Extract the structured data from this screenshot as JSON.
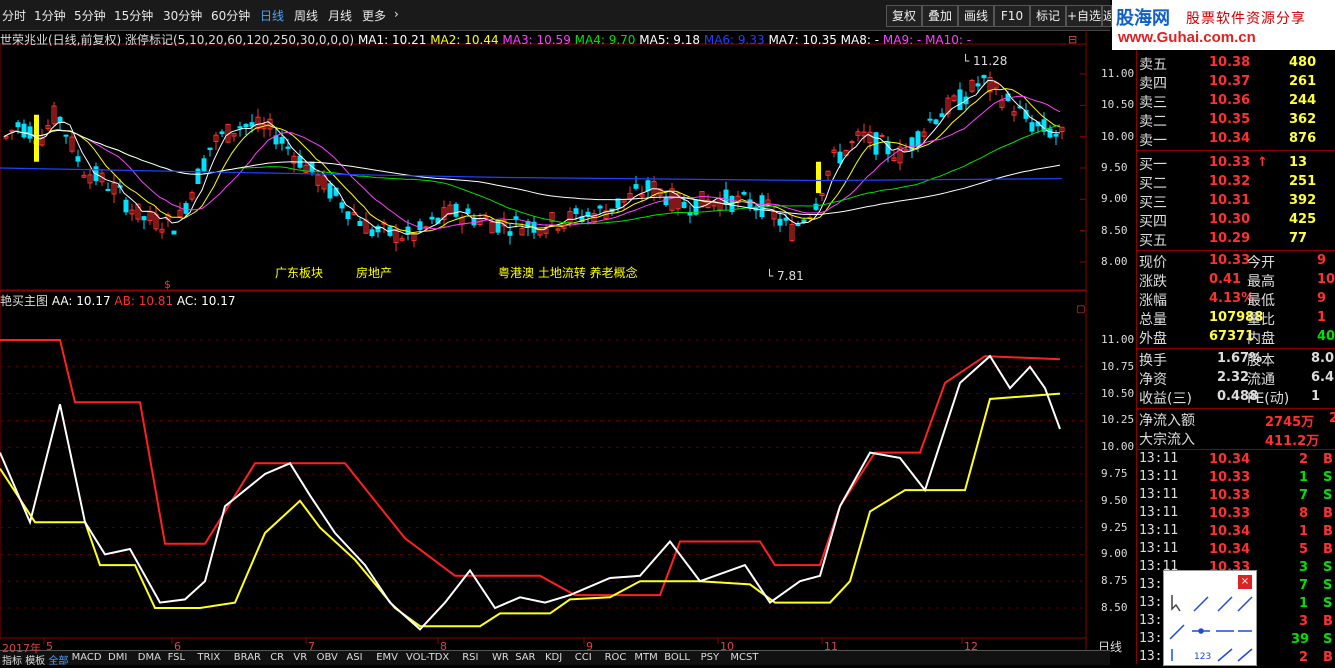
{
  "toolbar": {
    "periods": [
      "分时",
      "1分钟",
      "5分钟",
      "15分钟",
      "30分钟",
      "60分钟",
      "日线",
      "周线",
      "月线",
      "更多"
    ],
    "active_period": "日线",
    "buttons": [
      "复权",
      "叠加",
      "画线",
      "F10",
      "标记",
      "+自选",
      "返"
    ]
  },
  "logo": {
    "name": "股海网",
    "slogan": "股票软件资源分享",
    "url": "www.Guhai.com.cn"
  },
  "main_chart": {
    "header_prefix": "世荣兆业(日线,前复权) 涨停标记(5,10,20,60,120,250,30,0,0,0)",
    "ma_labels": [
      {
        "text": "MA1: 10.21",
        "color": "#ffffff"
      },
      {
        "text": "MA2: 10.44",
        "color": "#ffff00"
      },
      {
        "text": "MA3: 10.59",
        "color": "#ff40ff"
      },
      {
        "text": "MA4: 9.70",
        "color": "#00e000"
      },
      {
        "text": "MA5: 9.18",
        "color": "#ffffff"
      },
      {
        "text": "MA6: 9.33",
        "color": "#2040ff"
      },
      {
        "text": "MA7: 10.35",
        "color": "#ffffff"
      },
      {
        "text": "MA8: -",
        "color": "#ffffff"
      },
      {
        "text": "MA9: -",
        "color": "#ff40ff"
      },
      {
        "text": "MA10: -",
        "color": "#ff40ff"
      }
    ],
    "y_ticks": [
      "11.00",
      "10.50",
      "10.00",
      "9.50",
      "9.00",
      "8.50",
      "8.00"
    ],
    "high_label": "11.28",
    "low_label": "7.81",
    "concepts": [
      "广东板块",
      "房地产",
      "粤港澳 土地流转 养老概念"
    ],
    "marker": "$"
  },
  "sub_chart": {
    "title": "艳买主图",
    "labels": [
      {
        "text": "AA: 10.17",
        "color": "#ffffff"
      },
      {
        "text": "AB: 10.81",
        "color": "#ff3030"
      },
      {
        "text": "AC: 10.17",
        "color": "#ffffff"
      }
    ],
    "y_ticks": [
      "11.00",
      "10.75",
      "10.50",
      "10.25",
      "10.00",
      "9.75",
      "9.50",
      "9.25",
      "9.00",
      "8.75",
      "8.50"
    ]
  },
  "x_axis": [
    "2017年",
    "5",
    "6",
    "7",
    "8",
    "9",
    "10",
    "11",
    "12"
  ],
  "period_label": "日线",
  "order_book": {
    "asks": [
      {
        "label": "卖五",
        "price": "10.38",
        "vol": "480"
      },
      {
        "label": "卖四",
        "price": "10.37",
        "vol": "261"
      },
      {
        "label": "卖三",
        "price": "10.36",
        "vol": "244"
      },
      {
        "label": "卖二",
        "price": "10.35",
        "vol": "362"
      },
      {
        "label": "卖一",
        "price": "10.34",
        "vol": "876"
      }
    ],
    "bids": [
      {
        "label": "买一",
        "price": "10.33",
        "vol": "13",
        "arrow": "↑"
      },
      {
        "label": "买二",
        "price": "10.32",
        "vol": "251"
      },
      {
        "label": "买三",
        "price": "10.31",
        "vol": "392"
      },
      {
        "label": "买四",
        "price": "10.30",
        "vol": "425"
      },
      {
        "label": "买五",
        "price": "10.29",
        "vol": "77"
      }
    ]
  },
  "quote": [
    {
      "k1": "现价",
      "v1": "10.33",
      "k2": "今开",
      "v2": "9"
    },
    {
      "k1": "涨跌",
      "v1": "0.41",
      "k2": "最高",
      "v2": "10"
    },
    {
      "k1": "涨幅",
      "v1": "4.13%",
      "k2": "最低",
      "v2": "9"
    },
    {
      "k1": "总量",
      "v1": "107988",
      "k2": "量比",
      "v2": "1"
    },
    {
      "k1": "外盘",
      "v1": "67371",
      "k2": "内盘",
      "v2": "40"
    }
  ],
  "fundamentals": [
    {
      "k1": "换手",
      "v1": "1.67%",
      "k2": "股本",
      "v2": "8.0"
    },
    {
      "k1": "净资",
      "v1": "2.32",
      "k2": "流通",
      "v2": "6.4"
    },
    {
      "k1": "收益(三)",
      "v1": "0.488",
      "k2": "PE(动)",
      "v2": "1"
    }
  ],
  "flows": [
    {
      "k": "净流入额",
      "v": "2745万",
      "extra": "2"
    },
    {
      "k": "大宗流入",
      "v": "411.2万",
      "extra": ""
    }
  ],
  "ticks": [
    {
      "t": "13:11",
      "p": "10.34",
      "v": "2",
      "s": "B"
    },
    {
      "t": "13:11",
      "p": "10.33",
      "v": "1",
      "s": "S"
    },
    {
      "t": "13:11",
      "p": "10.33",
      "v": "7",
      "s": "S"
    },
    {
      "t": "13:11",
      "p": "10.33",
      "v": "8",
      "s": "B"
    },
    {
      "t": "13:11",
      "p": "10.34",
      "v": "1",
      "s": "B"
    },
    {
      "t": "13:11",
      "p": "10.34",
      "v": "5",
      "s": "B"
    },
    {
      "t": "13:11",
      "p": "10.33",
      "v": "3",
      "s": "S"
    },
    {
      "t": "13:11",
      "p": "",
      "v": "7",
      "s": "S"
    },
    {
      "t": "13:11",
      "p": "",
      "v": "1",
      "s": "S"
    },
    {
      "t": "13:11",
      "p": "",
      "v": "3",
      "s": "B"
    },
    {
      "t": "13:11",
      "p": "",
      "v": "39",
      "s": "S"
    },
    {
      "t": "13:11",
      "p": "",
      "v": "2",
      "s": "B"
    }
  ],
  "bottom_tabs": [
    "指标",
    "模板",
    "全部",
    "MACD",
    "DMI",
    "DMA",
    "FSL",
    "TRIX",
    "BRAR",
    "CR",
    "VR",
    "OBV",
    "ASI",
    "EMV",
    "VOL-TDX",
    "RSI",
    "WR",
    "SAR",
    "KDJ",
    "CCI",
    "ROC",
    "MTM",
    "BOLL",
    "PSY",
    "MCST"
  ],
  "active_tab": "全部",
  "colors": {
    "up": "#ff3030",
    "down": "#00e0ff",
    "ma_yellow": "#ffff00",
    "ma_magenta": "#ff40ff",
    "ma_green": "#00e000",
    "ma_blue": "#2040ff",
    "grid": "#8b0000"
  }
}
